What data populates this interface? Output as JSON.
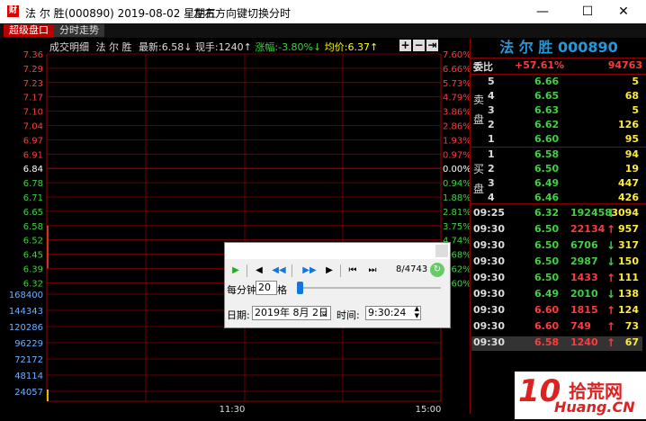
{
  "window": {
    "title": "法 尔 胜(000890) 2019-08-02 星期五",
    "hint": "左右方向键切换分时",
    "buttons": [
      "—",
      "☐",
      "✕"
    ]
  },
  "tabs": [
    {
      "label": "超级盘口"
    },
    {
      "label": "分时走势"
    }
  ],
  "chart": {
    "info": {
      "label": "成交明细",
      "name": "法 尔 胜",
      "latest_label": "最新:",
      "latest": "6.58↓",
      "volume_label": "现手:",
      "volume": "1240↑",
      "change_label": "涨幅:",
      "change": "-3.80%↓",
      "avg_label": "均价:",
      "avg": "6.37↑"
    },
    "price_ticks": [
      "7.36",
      "7.29",
      "7.23",
      "7.17",
      "7.10",
      "7.04",
      "6.97",
      "6.91",
      "6.84",
      "6.78",
      "6.71",
      "6.65",
      "6.58",
      "6.52",
      "6.45",
      "6.39",
      "6.32"
    ],
    "pct_ticks": [
      "7.60%",
      "6.66%",
      "5.73%",
      "4.79%",
      "3.86%",
      "2.86%",
      "1.93%",
      "0.97%",
      "0.00%",
      "0.94%",
      "1.88%",
      "2.81%",
      "3.75%",
      "4.74%",
      "5.68%",
      "6.62%",
      "7.60%"
    ],
    "volume_ticks": [
      "168400",
      "144343",
      "120286",
      "96229",
      "72172",
      "48114",
      "24057"
    ],
    "time_ticks": [
      "11:30",
      "15:00"
    ],
    "colors": {
      "up": "#ff3b3b",
      "down": "#3fd13f",
      "flat": "#ffffff",
      "grid": "#8b0000",
      "axis_blue": "#6fb0ff"
    }
  },
  "quote": {
    "stock_name": "法 尔 胜 000890",
    "weibi_label": "委比",
    "weibi_pct": "+57.61%",
    "weibi_val": "94763",
    "sell_label": "卖盘",
    "buy_label": "买盘",
    "asks": [
      {
        "level": "5",
        "price": "6.66",
        "vol": "5"
      },
      {
        "level": "4",
        "price": "6.65",
        "vol": "68"
      },
      {
        "level": "3",
        "price": "6.63",
        "vol": "5"
      },
      {
        "level": "2",
        "price": "6.62",
        "vol": "126"
      },
      {
        "level": "1",
        "price": "6.60",
        "vol": "95"
      }
    ],
    "bids": [
      {
        "level": "1",
        "price": "6.58",
        "vol": "94"
      },
      {
        "level": "2",
        "price": "6.50",
        "vol": "19"
      },
      {
        "level": "3",
        "price": "6.49",
        "vol": "447"
      },
      {
        "level": "4",
        "price": "6.46",
        "vol": "426"
      }
    ],
    "trades": [
      {
        "time": "09:25",
        "price": "6.32",
        "amount": "192458",
        "dir": "down",
        "vol": "3094"
      },
      {
        "time": "09:30",
        "price": "6.50",
        "amount": "22134",
        "dir": "up",
        "vol": "957"
      },
      {
        "time": "09:30",
        "price": "6.50",
        "amount": "6706",
        "dir": "down",
        "vol": "317"
      },
      {
        "time": "09:30",
        "price": "6.50",
        "amount": "2987",
        "dir": "down",
        "vol": "150"
      },
      {
        "time": "09:30",
        "price": "6.50",
        "amount": "1433",
        "dir": "up",
        "vol": "111"
      },
      {
        "time": "09:30",
        "price": "6.49",
        "amount": "2010",
        "dir": "down",
        "vol": "138"
      },
      {
        "time": "09:30",
        "price": "6.60",
        "amount": "1815",
        "dir": "up",
        "vol": "124"
      },
      {
        "time": "09:30",
        "price": "6.60",
        "amount": "749",
        "dir": "up",
        "vol": "73"
      },
      {
        "time": "09:30",
        "price": "6.58",
        "amount": "1240",
        "dir": "up",
        "vol": "67"
      }
    ]
  },
  "dialog": {
    "counter": "8/4743",
    "per_minute_label": "每分钟",
    "per_minute_value": "20",
    "grid_label": "格",
    "date_label": "日期:",
    "date_value": "2019年 8月 2日",
    "time_label": "时间:",
    "time_value": "9:30:24"
  },
  "watermark": {
    "text": "10 拾荒网 Huang.CN"
  }
}
